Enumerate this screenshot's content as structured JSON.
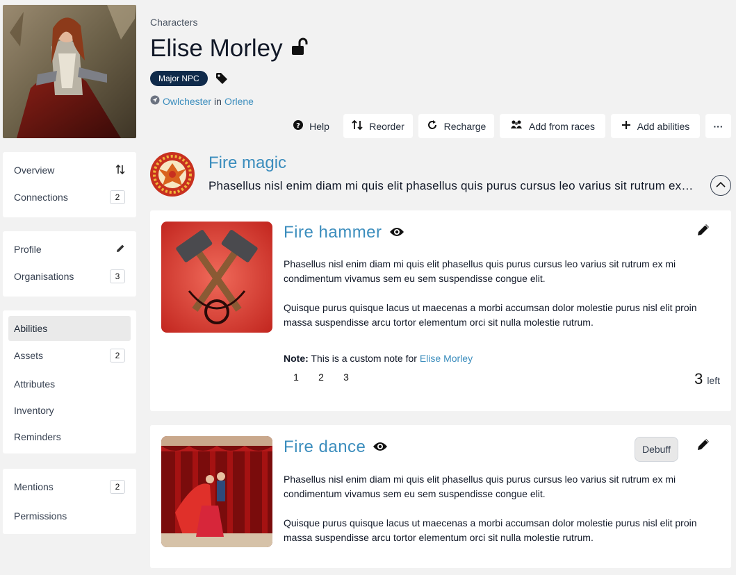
{
  "sidebar": {
    "groups": [
      [
        {
          "label": "Overview",
          "icon": "sort-arrows-icon"
        },
        {
          "label": "Connections",
          "count": "2"
        }
      ],
      [
        {
          "label": "Profile",
          "icon": "pencil-icon"
        },
        {
          "label": "Organisations",
          "count": "3"
        }
      ],
      [
        {
          "label": "Abilities",
          "active": true
        },
        {
          "label": "Assets",
          "count": "2"
        },
        {
          "label": "Attributes"
        },
        {
          "label": "Inventory"
        },
        {
          "label": "Reminders"
        }
      ],
      [
        {
          "label": "Mentions",
          "count": "2"
        },
        {
          "label": "Permissions"
        }
      ]
    ]
  },
  "header": {
    "breadcrumb": "Characters",
    "title": "Elise Morley",
    "lock_icon": "unlock-icon",
    "tag": "Major NPC",
    "location": {
      "place": "Owlchester",
      "connector": "in",
      "region": "Orlene"
    }
  },
  "toolbar": {
    "help": "Help",
    "reorder": "Reorder",
    "recharge": "Recharge",
    "add_from_races": "Add from races",
    "add_abilities": "Add abilities",
    "more": "···"
  },
  "parent_ability": {
    "name": "Fire magic",
    "description": "Phasellus nisl enim diam mi quis elit phasellus quis purus cursus leo varius sit rutrum ex mi"
  },
  "abilities": [
    {
      "name": "Fire hammer",
      "paragraph1": "Phasellus nisl enim diam mi quis elit phasellus quis purus cursus leo varius sit rutrum ex mi condimentum vivamus sem eu sem suspendisse congue elit.",
      "paragraph2": "Quisque purus quisque lacus ut maecenas a morbi accumsan dolor molestie purus nisl elit proin massa suspendisse arcu tortor elementum orci sit nulla molestie rutrum.",
      "note_label": "Note:",
      "note_text": "This is a custom note for",
      "note_link": "Elise Morley",
      "charges": [
        "1",
        "2",
        "3"
      ],
      "left_count": "3",
      "left_word": "left"
    },
    {
      "name": "Fire dance",
      "badge": "Debuff",
      "paragraph1": "Phasellus nisl enim diam mi quis elit phasellus quis purus cursus leo varius sit rutrum ex mi condimentum vivamus sem eu sem suspendisse congue elit.",
      "paragraph2": "Quisque purus quisque lacus ut maecenas a morbi accumsan dolor molestie purus nisl elit proin massa suspendisse arcu tortor elementum orci sit nulla molestie rutrum."
    }
  ],
  "colors": {
    "accent": "#3b8dbd",
    "tag_bg": "#0f2a4a",
    "page_bg": "#f2f2f2"
  }
}
